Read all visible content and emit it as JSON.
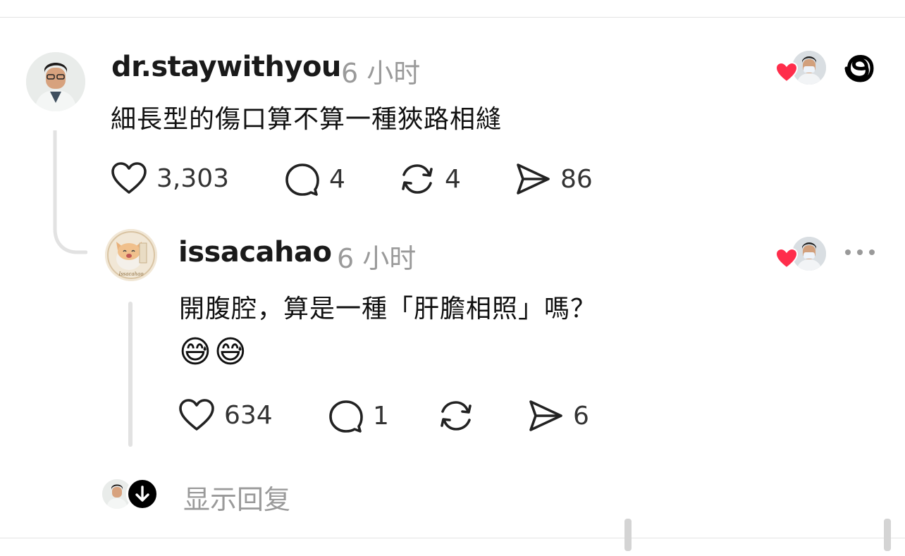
{
  "post": {
    "username": "dr.staywithyou",
    "time": "6 小时",
    "text": "細長型的傷口算不算一種狹路相縫",
    "likes": "3,303",
    "comments": "4",
    "reposts": "4",
    "shares": "86"
  },
  "reply": {
    "username": "issacahao",
    "time": "6 小时",
    "line1": "開腹腔，算是一種「肝膽相照」嗎？",
    "emoji": "😅😅",
    "likes": "634",
    "comments": "1",
    "shares": "6"
  },
  "footer": {
    "show_replies": "显示回复"
  },
  "colors": {
    "heart_badge": "#ff2d4b",
    "muted_text": "#9a9a9a",
    "thread_line": "#e2e2e2"
  },
  "icons": [
    "threads-logo-icon",
    "heart-icon",
    "comment-icon",
    "repost-icon",
    "share-icon",
    "more-icon",
    "arrow-down-icon"
  ]
}
